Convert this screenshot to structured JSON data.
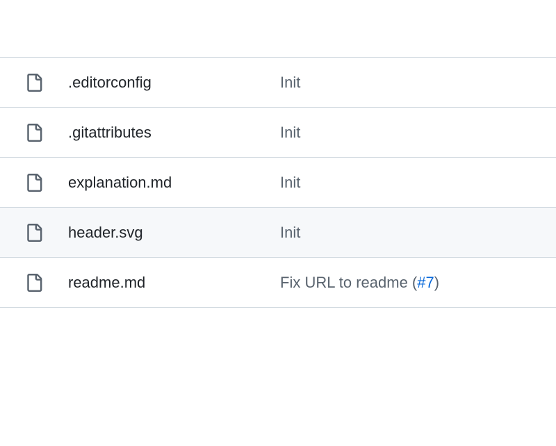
{
  "files": [
    {
      "name": ".editorconfig",
      "message": "Init",
      "issue": null,
      "hovered": false
    },
    {
      "name": ".gitattributes",
      "message": "Init",
      "issue": null,
      "hovered": false
    },
    {
      "name": "explanation.md",
      "message": "Init",
      "issue": null,
      "hovered": false
    },
    {
      "name": "header.svg",
      "message": "Init",
      "issue": null,
      "hovered": true
    },
    {
      "name": "readme.md",
      "message": "Fix URL to readme (",
      "issue": "#7",
      "messageSuffix": ")",
      "hovered": false
    }
  ]
}
